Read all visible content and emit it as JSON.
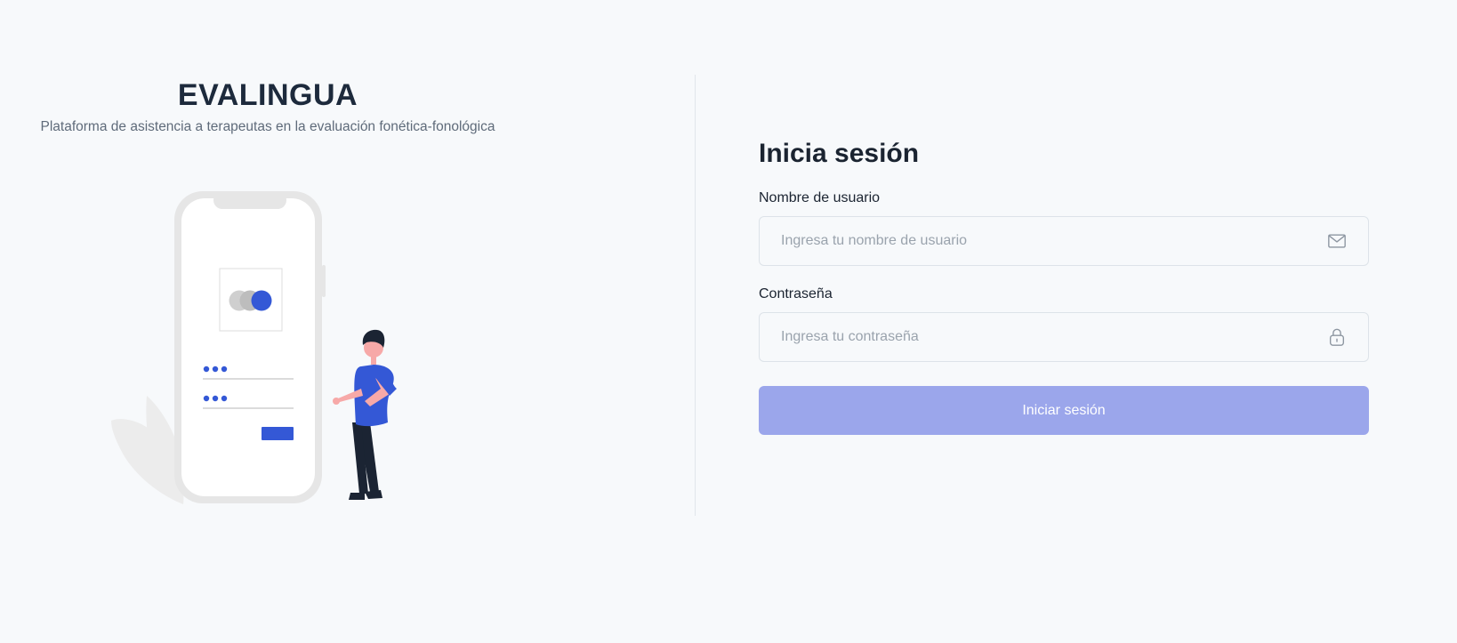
{
  "brand": {
    "title": "EVALINGUA",
    "subtitle": "Plataforma de asistencia a terapeutas en la evaluación fonética-fonológica"
  },
  "login": {
    "title": "Inicia sesión",
    "username_label": "Nombre de usuario",
    "username_placeholder": "Ingresa tu nombre de usuario",
    "username_value": "",
    "password_label": "Contraseña",
    "password_placeholder": "Ingresa tu contraseña",
    "password_value": "",
    "submit_label": "Iniciar sesión"
  },
  "icons": {
    "username": "envelope-icon",
    "password": "lock-icon"
  },
  "colors": {
    "background": "#f7f9fb",
    "text_primary": "#1b2431",
    "text_muted": "#5f6b7a",
    "accent": "#3458d6",
    "button_disabled": "#9ba6eb",
    "input_border": "#dde3e9"
  }
}
